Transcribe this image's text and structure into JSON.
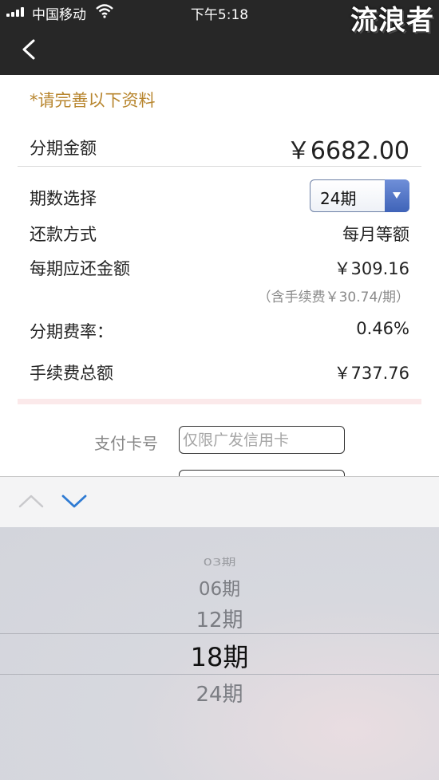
{
  "status": {
    "carrier": "中国移动",
    "time": "下午5:18"
  },
  "watermark": "流浪者",
  "form": {
    "notice": "*请完善以下资料",
    "amount": {
      "label": "分期金额",
      "value": "￥6682.00"
    },
    "period": {
      "label": "期数选择",
      "selected": "24期"
    },
    "repay_method": {
      "label": "还款方式",
      "value": "每月等额"
    },
    "per_period": {
      "label": "每期应还金额",
      "value": "￥309.16",
      "note": "（含手续费￥30.74/期）"
    },
    "rate": {
      "label": "分期费率：",
      "value": "0.46%"
    },
    "fee_total": {
      "label": "手续费总额",
      "value": "￥737.76"
    },
    "card": {
      "label": "支付卡号",
      "placeholder": "仅限广发信用卡"
    }
  },
  "picker": {
    "options": [
      "03期",
      "06期",
      "12期",
      "18期",
      "24期"
    ],
    "selected": "18期"
  },
  "colors": {
    "nav_bg": "#272727",
    "notice": "#b8862f",
    "select_arrow": "#4f72c8",
    "picker_arrow_active": "#2f7bd3"
  }
}
